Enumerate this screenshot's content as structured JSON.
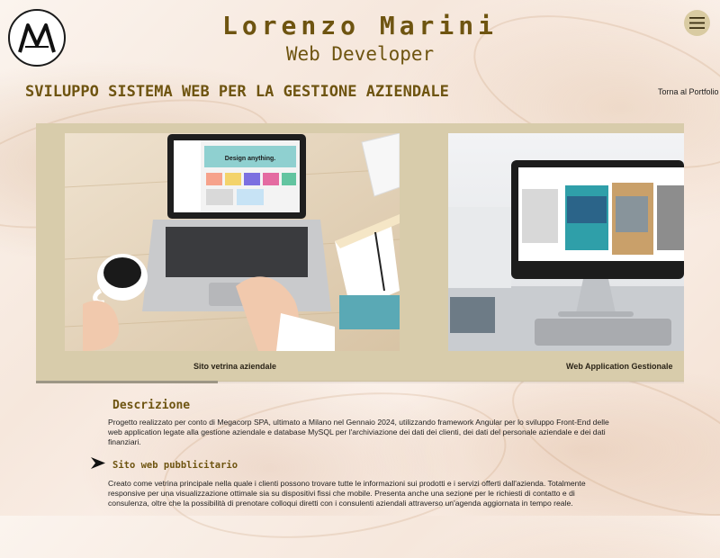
{
  "header": {
    "name": "Lorenzo Marini",
    "role": "Web Developer"
  },
  "page": {
    "title": "SVILUPPO SISTEMA WEB PER LA GESTIONE AZIENDALE",
    "back_link": "Torna al Portfolio"
  },
  "gallery": {
    "slides": [
      {
        "caption": "Sito vetrina aziendale",
        "screen_text": "Design anything."
      },
      {
        "caption": "Web Application Gestionale",
        "screen_text": ""
      }
    ],
    "progress": 0.28
  },
  "description": {
    "title": "Descrizione",
    "text": "Progetto realizzato per conto di Megacorp SPA, ultimato a Milano nel Gennaio 2024, utilizzando framework Angular per lo sviluppo Front-End delle web application legate alla gestione aziendale e database MySQL per l'archiviazione dei dati dei clienti, dei dati del personale aziendale e dei dati finanziari."
  },
  "feature": {
    "title": "Sito web pubblicitario",
    "text": "Creato come vetrina principale nella quale i clienti possono trovare tutte le informazioni sui prodotti e i servizi offerti dall'azienda. Totalmente responsive per una visualizzazione ottimale sia su dispositivi fissi che mobile. Presenta anche una sezione per le richiesti di contatto e di consulenza, oltre che la possibilità di prenotare colloqui diretti con i consulenti aziendali attraverso un'agenda aggiornata in tempo reale."
  },
  "icons": {
    "logo": "monogram-logo",
    "menu": "hamburger-icon",
    "bullet": "arrow-right-icon"
  },
  "colors": {
    "accent": "#6e5410",
    "gallery_bg": "#d8ccab",
    "menu_bg": "#d9cba2"
  }
}
